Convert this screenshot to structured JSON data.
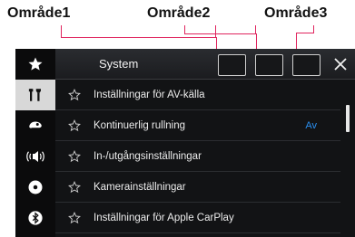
{
  "callouts": {
    "area1": "Område1",
    "area2": "Område2",
    "area3": "Område3"
  },
  "colors": {
    "leader": "#e0245e",
    "value_accent": "#2a8ff0",
    "active_tab": "#d8d8d8"
  },
  "header": {
    "title": "System",
    "close_icon": "close-icon"
  },
  "sidebar": {
    "items": [
      {
        "icon": "star-icon",
        "active": false
      },
      {
        "icon": "tools-icon",
        "active": true
      },
      {
        "icon": "car-icon",
        "active": false
      },
      {
        "icon": "speaker-icon",
        "active": false
      },
      {
        "icon": "disc-icon",
        "active": false
      },
      {
        "icon": "bluetooth-icon",
        "active": false
      }
    ]
  },
  "menu": {
    "items": [
      {
        "label": "Inställningar för AV-källa",
        "value": ""
      },
      {
        "label": "Kontinuerlig rullning",
        "value": "Av"
      },
      {
        "label": "In-/utgångsinställningar",
        "value": ""
      },
      {
        "label": "Kamerainställningar",
        "value": ""
      },
      {
        "label": "Inställningar för Apple CarPlay",
        "value": ""
      }
    ]
  }
}
